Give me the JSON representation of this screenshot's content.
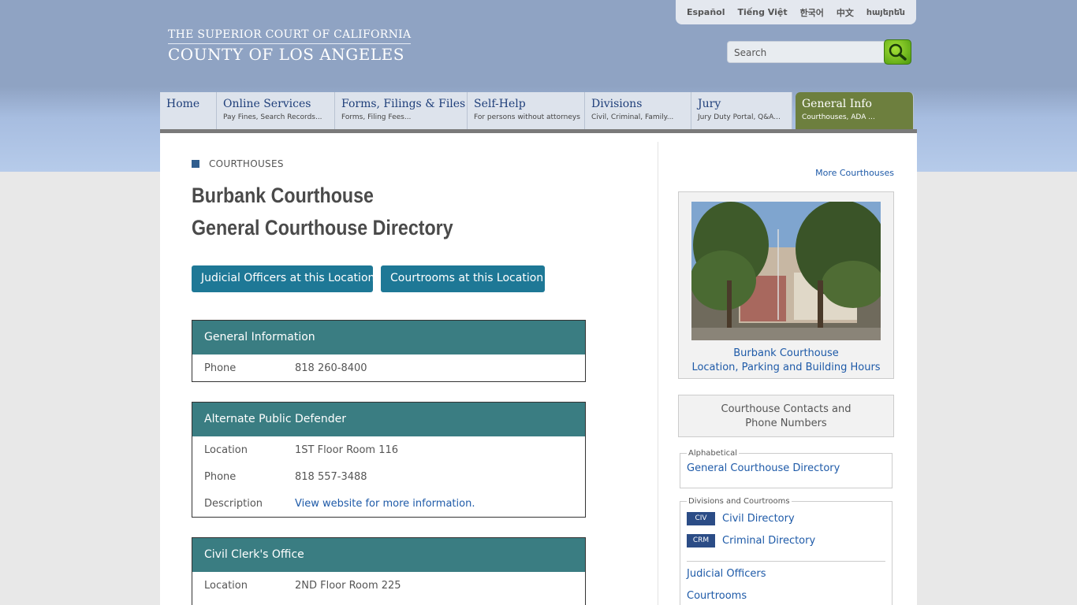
{
  "header": {
    "logo_line1": "THE SUPERIOR COURT OF CALIFORNIA",
    "logo_line2": "COUNTY OF LOS ANGELES",
    "languages": [
      "Español",
      "Tiếng Việt",
      "한국어",
      "中文",
      "հայերեն"
    ],
    "search_placeholder": "Search"
  },
  "nav": [
    {
      "title": "Home",
      "sub": ""
    },
    {
      "title": "Online Services",
      "sub": "Pay Fines, Search Records..."
    },
    {
      "title": "Forms, Filings & Files",
      "sub": "Forms, Filing Fees..."
    },
    {
      "title": "Self-Help",
      "sub": "For persons without attorneys"
    },
    {
      "title": "Divisions",
      "sub": "Civil, Criminal, Family..."
    },
    {
      "title": "Jury",
      "sub": "Jury Duty Portal, Q&A..."
    },
    {
      "title": "General Info",
      "sub": "Courthouses, ADA ..."
    }
  ],
  "main": {
    "section": "COURTHOUSES",
    "title_line1": "Burbank Courthouse",
    "title_line2": "General Courthouse Directory",
    "btn_officers": "Judicial Officers at this Location",
    "btn_courtrooms": "Courtrooms at this Location",
    "boxes": [
      {
        "title": "General Information",
        "rows": [
          {
            "k": "Phone",
            "v": "818 260-8400"
          }
        ]
      },
      {
        "title": "Alternate Public Defender",
        "rows": [
          {
            "k": "Location",
            "v": "1ST Floor Room 116"
          },
          {
            "k": "Phone",
            "v": "818 557-3488"
          },
          {
            "k": "Description",
            "v": "View website for more information."
          }
        ]
      },
      {
        "title": "Civil Clerk's Office",
        "rows": [
          {
            "k": "Location",
            "v": "2ND Floor Room 225"
          }
        ]
      }
    ]
  },
  "sidebar": {
    "more_courthouses": "More Courthouses",
    "photo_caption_line1": "Burbank Courthouse",
    "photo_caption_line2": "Location, Parking and Building Hours",
    "contacts_line1": "Courthouse Contacts and",
    "contacts_line2": "Phone Numbers",
    "alpha_legend": "Alphabetical",
    "alpha_link": "General Courthouse Directory",
    "div_legend": "Divisions and Courtrooms",
    "civ_badge": "CIV",
    "civ_link": "Civil Directory",
    "crm_badge": "CRM",
    "crm_link": "Criminal Directory",
    "judicial_link": "Judicial Officers",
    "courtrooms_link": "Courtrooms"
  }
}
